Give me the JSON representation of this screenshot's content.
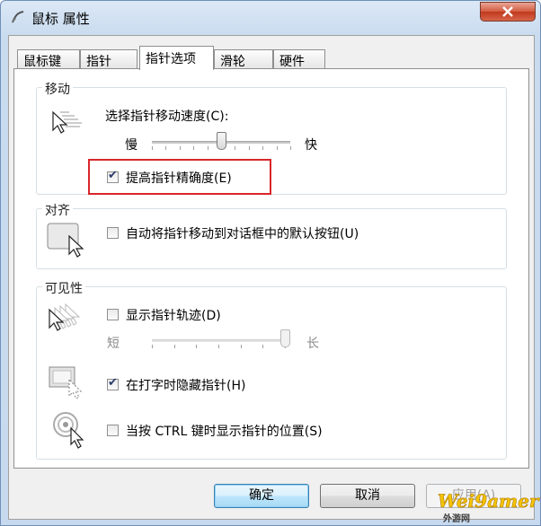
{
  "window": {
    "title": "鼠标 属性"
  },
  "tabs": [
    {
      "label": "鼠标键"
    },
    {
      "label": "指针"
    },
    {
      "label": "指针选项"
    },
    {
      "label": "滑轮"
    },
    {
      "label": "硬件"
    }
  ],
  "motion": {
    "group_label": "移动",
    "speed_label": "选择指针移动速度(C):",
    "slow_label": "慢",
    "fast_label": "快",
    "speed_level": 0.5,
    "enhance_precision_label": "提高指针精确度(E)",
    "enhance_precision_checked": true
  },
  "snap_to": {
    "group_label": "对齐",
    "snap_label": "自动将指针移动到对话框中的默认按钮(U)",
    "snap_checked": false
  },
  "visibility": {
    "group_label": "可见性",
    "trails_label": "显示指针轨迹(D)",
    "trails_checked": false,
    "short_label": "短",
    "long_label": "长",
    "trail_level": 1.0,
    "hide_typing_label": "在打字时隐藏指针(H)",
    "hide_typing_checked": true,
    "ctrl_location_label": "当按 CTRL 键时显示指针的位置(S)",
    "ctrl_location_checked": false
  },
  "buttons": {
    "ok": "确定",
    "cancel": "取消",
    "apply": "应用(A)"
  },
  "watermark": {
    "text": "Wei9amer",
    "sub": "外游网"
  },
  "colors": {
    "highlight_box": "#d9262a",
    "accent": "#3c7fb1"
  }
}
